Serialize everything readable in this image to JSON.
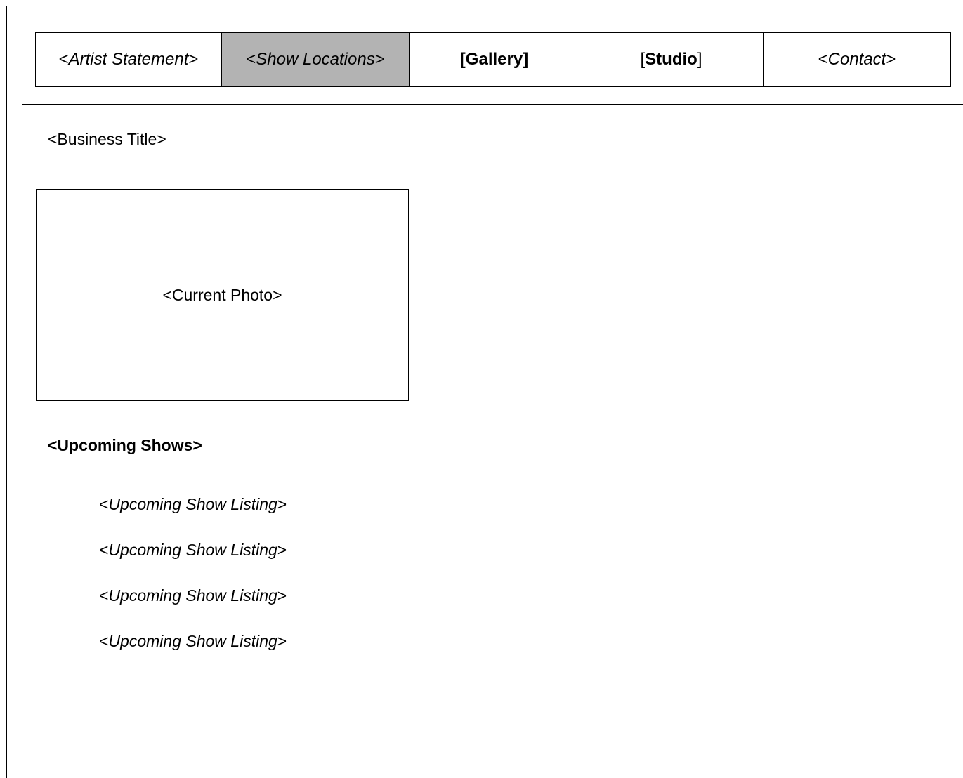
{
  "nav": {
    "items": [
      {
        "open": "<",
        "label": "Artist Statement",
        "close": ">"
      },
      {
        "open": "<",
        "label": "Show Locations",
        "close": ">"
      },
      {
        "open": "[",
        "label": "Gallery",
        "close": "]"
      },
      {
        "open": "[",
        "label": "Studio",
        "close": "]"
      },
      {
        "open": "<",
        "label": "Contact",
        "close": ">"
      }
    ]
  },
  "header": {
    "business_title": "<Business Title>"
  },
  "photo": {
    "label": "<Current Photo>"
  },
  "upcoming": {
    "heading": "<Upcoming Shows>",
    "listings": [
      {
        "open": "<",
        "label": "Upcoming Show Listing",
        "close": ">"
      },
      {
        "open": "<",
        "label": "Upcoming Show Listing",
        "close": ">"
      },
      {
        "open": "<",
        "label": "Upcoming Show Listing",
        "close": ">"
      },
      {
        "open": "<",
        "label": "Upcoming Show Listing",
        "close": ">"
      }
    ]
  },
  "colors": {
    "active_tab": "#b3b3b3",
    "border": "#000000",
    "background": "#ffffff"
  }
}
